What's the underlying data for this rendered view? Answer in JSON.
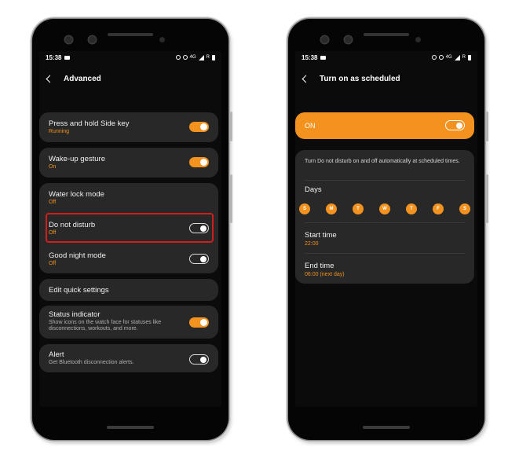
{
  "left": {
    "status": {
      "time": "15:38",
      "network": "4G",
      "carrier": "R"
    },
    "title": "Advanced",
    "items": [
      {
        "title": "Press and hold Side key",
        "sub": "Running",
        "toggle": "on"
      },
      {
        "title": "Wake-up gesture",
        "sub": "On",
        "toggle": "on"
      },
      {
        "title": "Water lock mode",
        "sub": "Off"
      },
      {
        "title": "Do not disturb",
        "sub": "Off",
        "toggle": "off"
      },
      {
        "title": "Good night mode",
        "sub": "Off",
        "toggle": "off"
      },
      {
        "title": "Edit quick settings"
      },
      {
        "title": "Status indicator",
        "desc": "Show icons on the watch face for statuses like disconnections, workouts, and more.",
        "toggle": "on"
      },
      {
        "title": "Alert",
        "desc": "Get Bluetooth disconnection alerts.",
        "toggle": "off"
      }
    ]
  },
  "right": {
    "status": {
      "time": "15:38",
      "network": "4G",
      "carrier": "R"
    },
    "title": "Turn on as scheduled",
    "on_label": "ON",
    "description": "Turn Do not disturb on and off automatically at scheduled times.",
    "days_title": "Days",
    "days": [
      "S",
      "M",
      "T",
      "W",
      "T",
      "F",
      "S"
    ],
    "start_title": "Start time",
    "start_value": "22:00",
    "end_title": "End time",
    "end_value": "06:00 (next day)"
  },
  "colors": {
    "accent": "#f3921e",
    "highlight": "#d21d1d",
    "card": "#282828"
  }
}
